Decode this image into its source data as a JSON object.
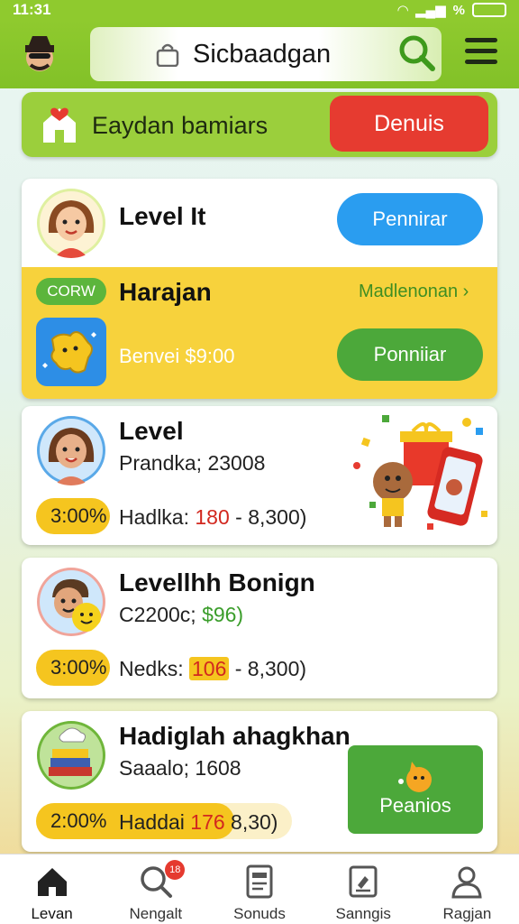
{
  "status_bar": {
    "time": "11:31",
    "battery_text": "%"
  },
  "header": {
    "title": "Sicbaadgan"
  },
  "banner": {
    "text": "Eaydan bamiars",
    "button_label": "Denuis"
  },
  "card1": {
    "title": "Level It",
    "button_label": "Pennirar",
    "yellow": {
      "tag": "CORW",
      "title": "Harajan",
      "link": "Madlenonan",
      "subtitle": "Benvei $9:00",
      "button_label": "Ponniiar"
    }
  },
  "card2": {
    "title": "Level",
    "line1": "Prandka; 23008",
    "pct": "3:00%",
    "line2_prefix": "Hadlka:",
    "line2_highlight": "180",
    "line2_suffix": "- 8,300)"
  },
  "card3": {
    "title": "Levellhh Bonign",
    "line1_prefix": "C2200c;",
    "line1_highlight": "$96)",
    "pct": "3:00%",
    "line2_prefix": "Nedks:",
    "line2_highlight": "106",
    "line2_suffix": "- 8,300)"
  },
  "card4": {
    "title": "Hadiglah ahagkhan",
    "line1": "Saaalo; 1608",
    "pct": "2:00%",
    "line2_prefix": "Haddai",
    "line2_highlight": "176",
    "line2_suffix": "8,30)",
    "button_label": "Peanios"
  },
  "nav": {
    "items": [
      {
        "label": "Levan",
        "icon": "home-icon"
      },
      {
        "label": "Nengalt",
        "icon": "search-icon",
        "badge": "18"
      },
      {
        "label": "Sonuds",
        "icon": "document-icon"
      },
      {
        "label": "Sanngis",
        "icon": "clipboard-icon"
      },
      {
        "label": "Ragjan",
        "icon": "profile-icon"
      }
    ]
  },
  "colors": {
    "accent_green": "#8fca2e",
    "alert_red": "#e63b30",
    "primary_blue": "#2a9df0",
    "highlight_yellow": "#f5c51f"
  }
}
